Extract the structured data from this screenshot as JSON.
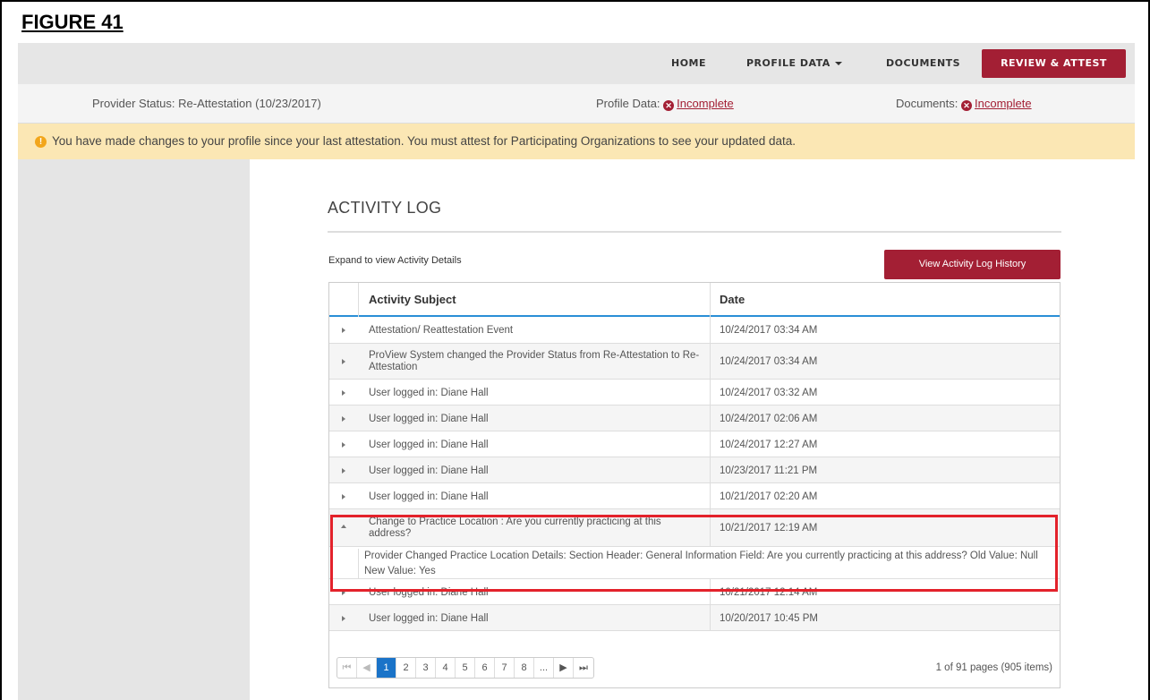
{
  "figure_label": "FIGURE 41",
  "nav": {
    "home": "HOME",
    "profile_data": "PROFILE DATA",
    "documents": "DOCUMENTS",
    "review_attest": "REVIEW & ATTEST"
  },
  "status": {
    "provider_label": "Provider Status:",
    "provider_value": "Re-Attestation (10/23/2017)",
    "profile_label": "Profile Data:",
    "profile_value": "Incomplete",
    "documents_label": "Documents:",
    "documents_value": "Incomplete"
  },
  "alert": {
    "icon": "!",
    "text": "You have made changes to your profile since your last attestation. You must attest for Participating Organizations to see your updated data."
  },
  "activity": {
    "title": "ACTIVITY LOG",
    "expand_hint": "Expand to view Activity Details",
    "history_button": "View Activity Log History",
    "columns": {
      "subject": "Activity Subject",
      "date": "Date"
    },
    "rows": [
      {
        "subject": "Attestation/ Reattestation Event",
        "date": "10/24/2017 03:34 AM"
      },
      {
        "subject": "ProView System changed the Provider Status from Re-Attestation to Re-Attestation",
        "date": "10/24/2017 03:34 AM"
      },
      {
        "subject": "User logged in: Diane Hall",
        "date": "10/24/2017 03:32 AM"
      },
      {
        "subject": "User logged in: Diane Hall",
        "date": "10/24/2017 02:06 AM"
      },
      {
        "subject": "User logged in: Diane Hall",
        "date": "10/24/2017 12:27 AM"
      },
      {
        "subject": "User logged in: Diane Hall",
        "date": "10/23/2017 11:21 PM"
      },
      {
        "subject": "User logged in: Diane Hall",
        "date": "10/21/2017 02:20 AM"
      },
      {
        "subject": "Change to Practice Location : Are you currently practicing at this address?",
        "date": "10/21/2017 12:19 AM"
      },
      {
        "subject": "User logged in: Diane Hall",
        "date": "10/21/2017 12:14 AM"
      },
      {
        "subject": "User logged in: Diane Hall",
        "date": "10/20/2017 10:45 PM"
      }
    ],
    "expanded_detail": "Provider Changed Practice Location Details: Section Header: General Information Field: Are you currently practicing at this address? Old Value: Null New Value: Yes",
    "pager": {
      "first": "⏮",
      "prev": "◀",
      "pages": [
        "1",
        "2",
        "3",
        "4",
        "5",
        "6",
        "7",
        "8",
        "..."
      ],
      "current_page": "1",
      "next": "▶",
      "last": "⏭",
      "info": "1 of 91 pages (905 items)"
    }
  }
}
